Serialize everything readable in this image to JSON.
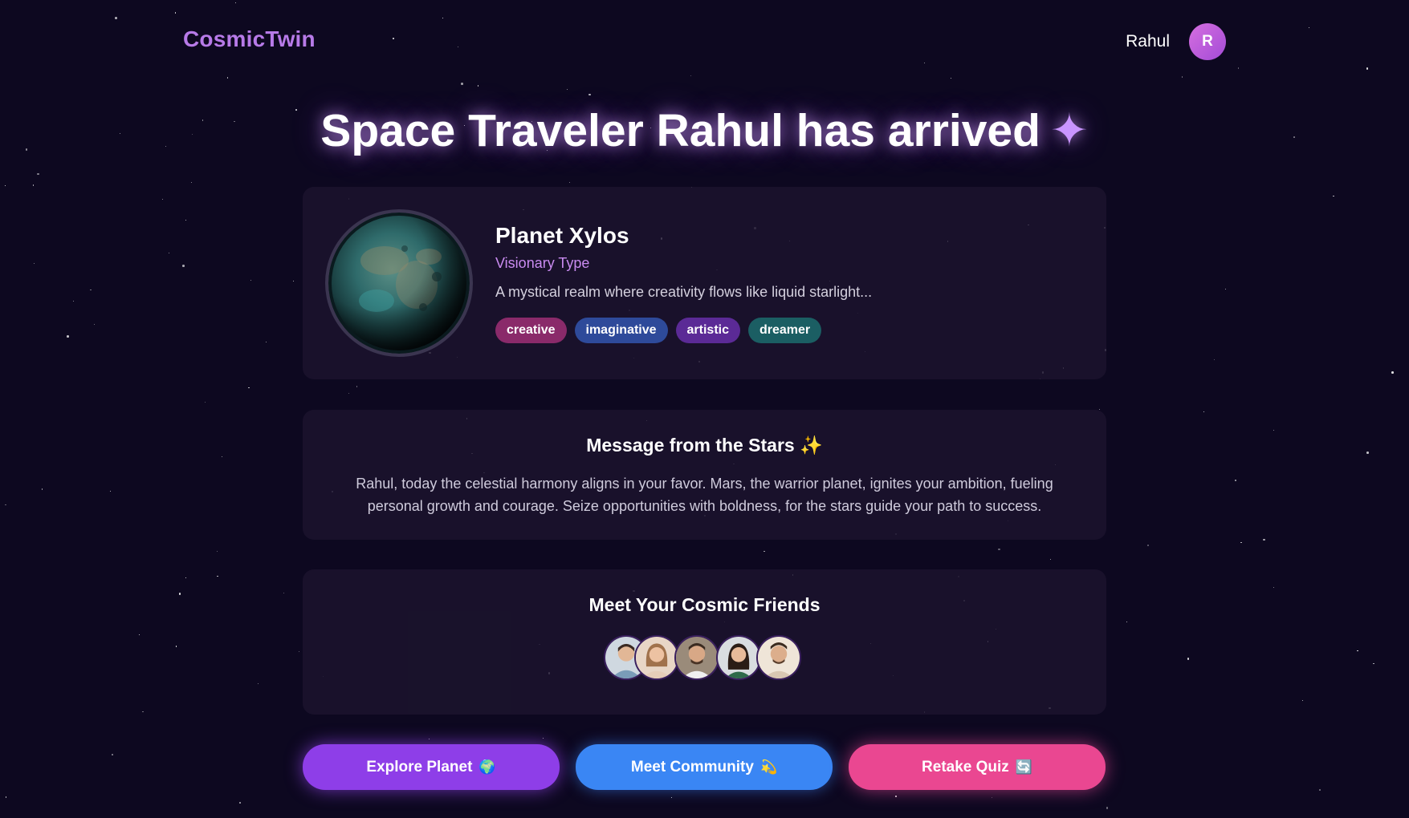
{
  "header": {
    "logo": "CosmicTwin",
    "user_name": "Rahul",
    "avatar_initial": "R"
  },
  "hero": {
    "title": "Space Traveler Rahul has arrived",
    "sparkle": "✦"
  },
  "planet_card": {
    "name": "Planet Xylos",
    "type": "Visionary Type",
    "description": "A mystical realm where creativity flows like liquid starlight...",
    "tags": [
      {
        "label": "creative",
        "color": "#8a2a6a"
      },
      {
        "label": "imaginative",
        "color": "#2e4a9a"
      },
      {
        "label": "artistic",
        "color": "#5b2a96"
      },
      {
        "label": "dreamer",
        "color": "#1b5e63"
      }
    ]
  },
  "message_card": {
    "title": "Message from the Stars",
    "title_emoji": "✨",
    "body": "Rahul, today the celestial harmony aligns in your favor. Mars, the warrior planet, ignites your ambition, fueling personal growth and courage. Seize opportunities with boldness, for the stars guide your path to success."
  },
  "friends_card": {
    "title": "Meet Your Cosmic Friends"
  },
  "actions": {
    "explore_label": "Explore Planet",
    "explore_emoji": "🌍",
    "community_label": "Meet Community",
    "community_emoji": "💫",
    "retake_label": "Retake Quiz",
    "retake_emoji": "🔄"
  },
  "colors": {
    "background": "#0d0820",
    "logo": "#b77ae8",
    "accent_purple": "#8e3ee8",
    "accent_blue": "#3a86f4",
    "accent_pink": "#ea4791"
  }
}
